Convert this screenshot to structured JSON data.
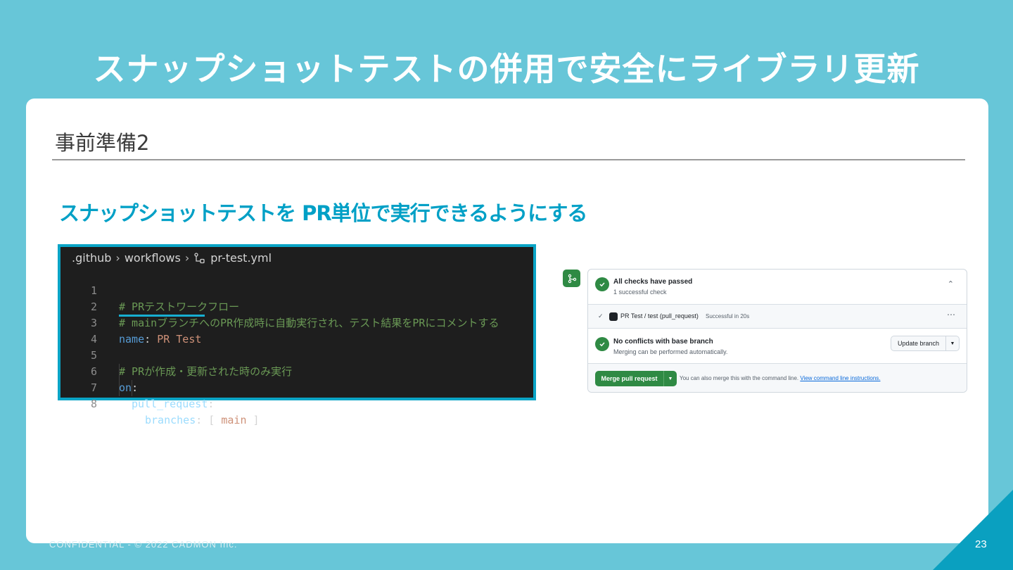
{
  "slide": {
    "title": "スナップショットテストの併用で安全にライブラリ更新",
    "section_heading": "事前準備2",
    "subheading": "スナップショットテストを PR単位で実行できるようにする",
    "footer": "CONFIDENTIAL - © 2022 CADMON Inc.",
    "page_number": "23"
  },
  "editor": {
    "breadcrumb": [
      ".github",
      "workflows",
      "pr-test.yml"
    ],
    "lines": [
      {
        "no": "1",
        "text": "# PRテストワークフロー"
      },
      {
        "no": "2",
        "text": "# mainブランチへのPR作成時に自動実行され、テスト結果をPRにコメントする"
      },
      {
        "no": "3",
        "key": "name",
        "value": "PR Test"
      },
      {
        "no": "4",
        "text": ""
      },
      {
        "no": "5",
        "text": "# PRが作成・更新された時のみ実行"
      },
      {
        "no": "6",
        "key": "on"
      },
      {
        "no": "7",
        "key": "pull_request"
      },
      {
        "no": "8",
        "key": "branches",
        "value": "main"
      }
    ]
  },
  "pr_panel": {
    "checks_title": "All checks have passed",
    "checks_sub": "1 successful check",
    "check_name": "PR Test / test (pull_request)",
    "check_status": "Successful in 20s",
    "conflicts_title": "No conflicts with base branch",
    "conflicts_sub": "Merging can be performed automatically.",
    "update_label": "Update branch",
    "merge_label": "Merge pull request",
    "merge_note": "You can also merge this with the command line.",
    "merge_link": "View command line instructions."
  },
  "colors": {
    "background": "#67c6d8",
    "accent": "#00a0c6",
    "success": "#2f8a44"
  }
}
